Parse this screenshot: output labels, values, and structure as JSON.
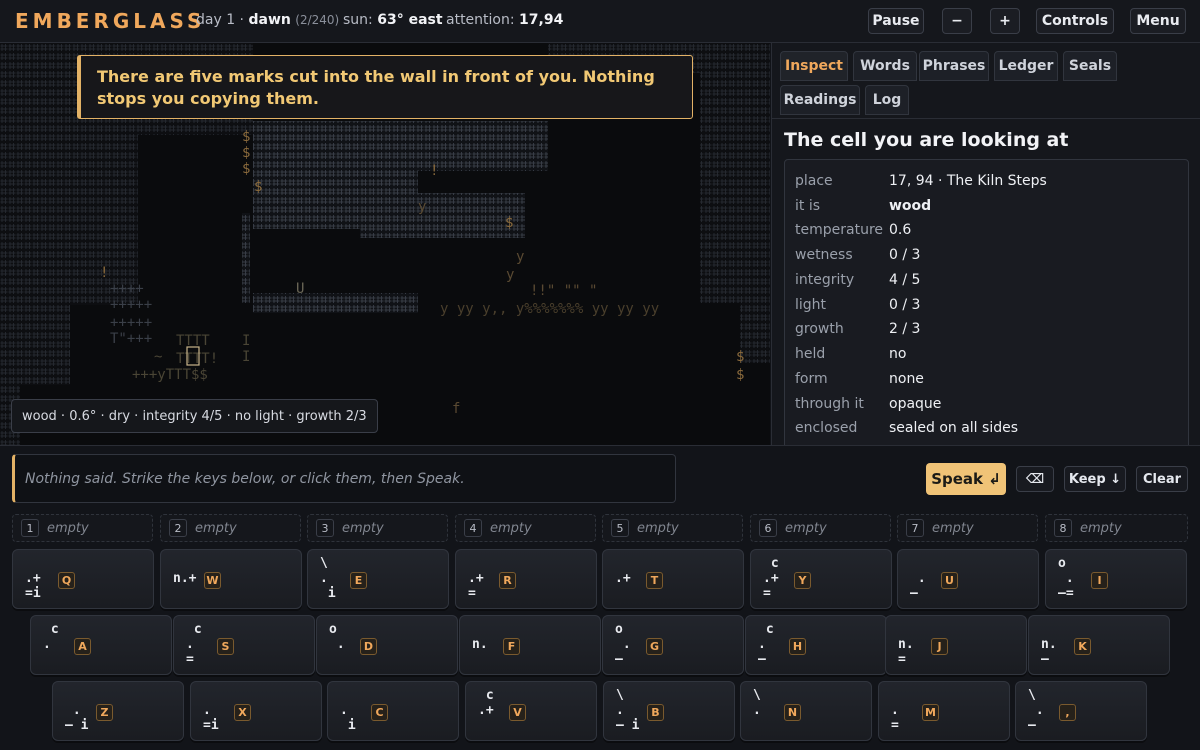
{
  "header": {
    "brand": "EMBERGLASS",
    "day": "day 1 · ",
    "phase": "dawn",
    "phase_progress": "(2/240)",
    "sun_label": "sun: ",
    "sun_value": "63° east",
    "attention_label": "attention: ",
    "attention_value": "17,94",
    "pause_label": "Pause",
    "minus_label": "−",
    "plus_label": "+",
    "controls_label": "Controls",
    "menu_label": "Menu"
  },
  "map": {
    "notice": "There are five marks cut into the wall in front of you. Nothing stops you copying them.",
    "cell_summary": "wood · 0.6° · dry · integrity 4/5 · no light · growth 2/3",
    "colors": {
      "wall": "#3a3f48",
      "wood": "#5a4a32",
      "accent": "#d08a3c",
      "cursor": "#c9b58a"
    }
  },
  "panel": {
    "tabs": [
      "Inspect",
      "Words",
      "Phrases",
      "Ledger",
      "Seals",
      "Readings",
      "Log"
    ],
    "active_tab": "Inspect",
    "title": "The cell you are looking at",
    "rows": [
      {
        "k": "place",
        "v": "17, 94 · The Kiln Steps"
      },
      {
        "k": "it is",
        "v": "wood"
      },
      {
        "k": "temperature",
        "v": "0.6"
      },
      {
        "k": "wetness",
        "v": "0 / 3"
      },
      {
        "k": "integrity",
        "v": "4 / 5"
      },
      {
        "k": "light",
        "v": "0 / 3"
      },
      {
        "k": "growth",
        "v": "2 / 3"
      },
      {
        "k": "held",
        "v": "no"
      },
      {
        "k": "form",
        "v": "none"
      },
      {
        "k": "through it",
        "v": "opaque"
      },
      {
        "k": "enclosed",
        "v": "sealed on all sides"
      }
    ]
  },
  "speech": {
    "placeholder": "Nothing said. Strike the keys below, or click them, then Speak.",
    "speak_label": "Speak ↲",
    "backspace_label": "⌫",
    "keep_label": "Keep ↓",
    "clear_label": "Clear"
  },
  "slots": [
    {
      "num": "1",
      "label": "empty"
    },
    {
      "num": "2",
      "label": "empty"
    },
    {
      "num": "3",
      "label": "empty"
    },
    {
      "num": "4",
      "label": "empty"
    },
    {
      "num": "5",
      "label": "empty"
    },
    {
      "num": "6",
      "label": "empty"
    },
    {
      "num": "7",
      "label": "empty"
    },
    {
      "num": "8",
      "label": "empty"
    }
  ],
  "keys": {
    "row1": [
      {
        "key": "Q",
        "glyph": "\n.+\n=i"
      },
      {
        "key": "W",
        "glyph": "\nn.+\n"
      },
      {
        "key": "E",
        "glyph": "\\\n.\n i"
      },
      {
        "key": "R",
        "glyph": "\n.+\n="
      },
      {
        "key": "T",
        "glyph": "\n.+\n"
      },
      {
        "key": "Y",
        "glyph": " c\n.+\n="
      },
      {
        "key": "U",
        "glyph": "\n .\n–"
      },
      {
        "key": "I",
        "glyph": "o\n .\n–="
      }
    ],
    "row2": [
      {
        "key": "A",
        "glyph": " c\n.\n"
      },
      {
        "key": "S",
        "glyph": " c\n.\n="
      },
      {
        "key": "D",
        "glyph": "o\n .\n"
      },
      {
        "key": "F",
        "glyph": "\nn.\n"
      },
      {
        "key": "G",
        "glyph": "o\n .\n–"
      },
      {
        "key": "H",
        "glyph": " c\n.\n–"
      },
      {
        "key": "J",
        "glyph": "\nn.\n="
      },
      {
        "key": "K",
        "glyph": "\nn.\n–"
      }
    ],
    "row3": [
      {
        "key": "Z",
        "glyph": "\n .\n– i"
      },
      {
        "key": "X",
        "glyph": "\n.\n=i"
      },
      {
        "key": "C",
        "glyph": "\n.\n i"
      },
      {
        "key": "V",
        "glyph": " c\n.+\n"
      },
      {
        "key": "B",
        "glyph": "\\\n.\n– i"
      },
      {
        "key": "N",
        "glyph": "\\\n.\n"
      },
      {
        "key": "M",
        "glyph": "\n.\n="
      },
      {
        "key": ",",
        "glyph": "\\\n .\n–"
      }
    ]
  }
}
